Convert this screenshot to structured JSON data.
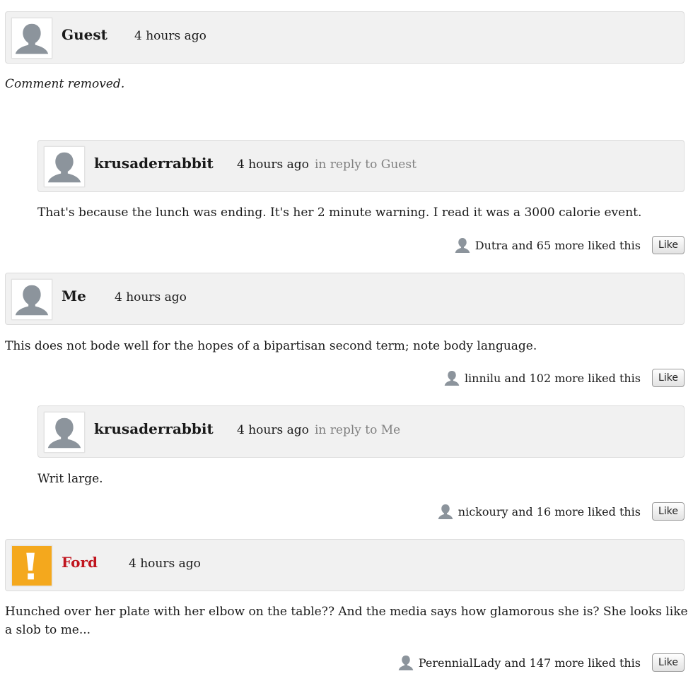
{
  "comments": [
    {
      "author": "Guest",
      "time": "4 hours ago",
      "avatar_icon": "default-avatar-icon",
      "text": "Comment removed."
    },
    {
      "author": "krusaderrabbit",
      "time": "4 hours ago",
      "reply_to": "in reply to Guest",
      "avatar_icon": "default-avatar-icon",
      "text": "That's because the lunch was ending. It's her 2 minute warning. I read it was a 3000 calorie event.",
      "likes_text": "Dutra and 65 more liked this",
      "like_label": "Like"
    },
    {
      "author": "Me",
      "time": "4 hours ago",
      "avatar_icon": "default-avatar-icon",
      "text": "This does not bode well for the hopes of a bipartisan second term; note body language.",
      "likes_text": "linnilu and 102 more liked this",
      "like_label": "Like"
    },
    {
      "author": "krusaderrabbit",
      "time": "4 hours ago",
      "reply_to": "in reply to Me",
      "avatar_icon": "default-avatar-icon",
      "text": "Writ large.",
      "likes_text": "nickoury and 16 more liked this",
      "like_label": "Like"
    },
    {
      "author": "Ford",
      "time": "4 hours ago",
      "avatar_icon": "exclamation-logo-icon",
      "author_color": "#c0141e",
      "avatar_color": "#f4a81d",
      "text": "Hunched over her plate with her elbow on the table??  And the media says how glamorous she is?  She looks like a slob to me...",
      "likes_text": "PerennialLady and 147 more liked this",
      "like_label": "Like"
    }
  ],
  "colors": {
    "header_bg": "#f1f1f1",
    "header_border": "#dcdcdc",
    "avatar_gray": "#8c949c",
    "reply_gray": "#808080"
  }
}
